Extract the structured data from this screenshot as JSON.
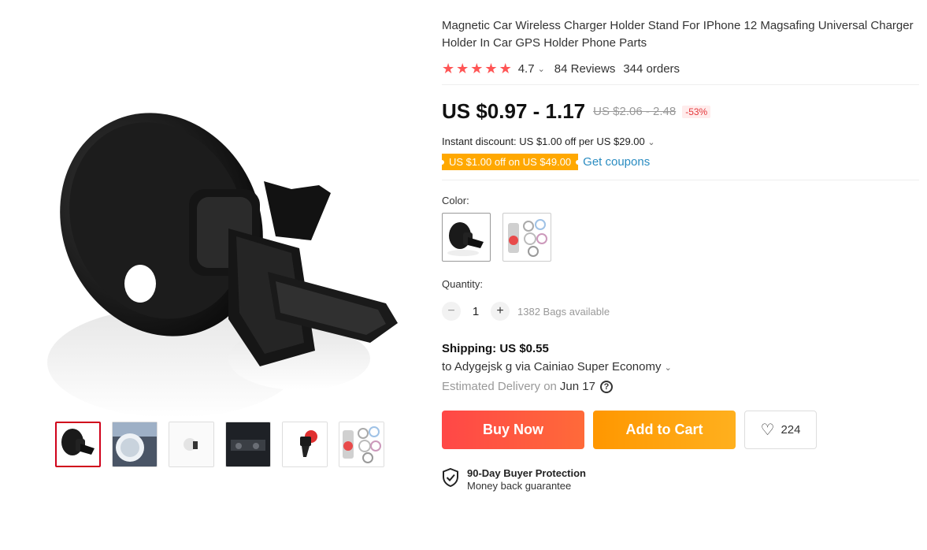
{
  "product": {
    "title": "Magnetic Car Wireless Charger Holder Stand For IPhone 12 Magsafing Universal Charger Holder In Car GPS Holder Phone Parts",
    "rating": "4.7",
    "reviews": "84 Reviews",
    "orders": "344 orders"
  },
  "price": {
    "current": "US $0.97 - 1.17",
    "original": "US $2.06 - 2.48",
    "discount": "-53%"
  },
  "promo": {
    "instant_discount": "Instant discount: US $1.00 off per US $29.00",
    "coupon": "US $1.00 off on US $49.00",
    "get_coupons": "Get coupons"
  },
  "color": {
    "label": "Color:"
  },
  "quantity": {
    "label": "Quantity:",
    "value": "1",
    "minus": "−",
    "plus": "+",
    "available": "1382 Bags available"
  },
  "shipping": {
    "title": "Shipping: US $0.55",
    "to": "to Adygejsk g via Cainiao Super Economy",
    "est_label": "Estimated Delivery on",
    "est_date": "Jun 17",
    "help": "?"
  },
  "actions": {
    "buy_now": "Buy Now",
    "add_to_cart": "Add to Cart",
    "wishlist_count": "224"
  },
  "protection": {
    "title": "90-Day Buyer Protection",
    "subtitle": "Money back guarantee"
  },
  "icons": {
    "star": "star-icon",
    "chevron": "chevron-down-icon",
    "heart": "heart-icon",
    "shield": "shield-check-icon"
  },
  "colors": {
    "accent_red": "#ff4747",
    "accent_orange": "#ff9700",
    "coupon": "#ffa800",
    "link": "#2a8cc1",
    "star": "#ff5555"
  }
}
